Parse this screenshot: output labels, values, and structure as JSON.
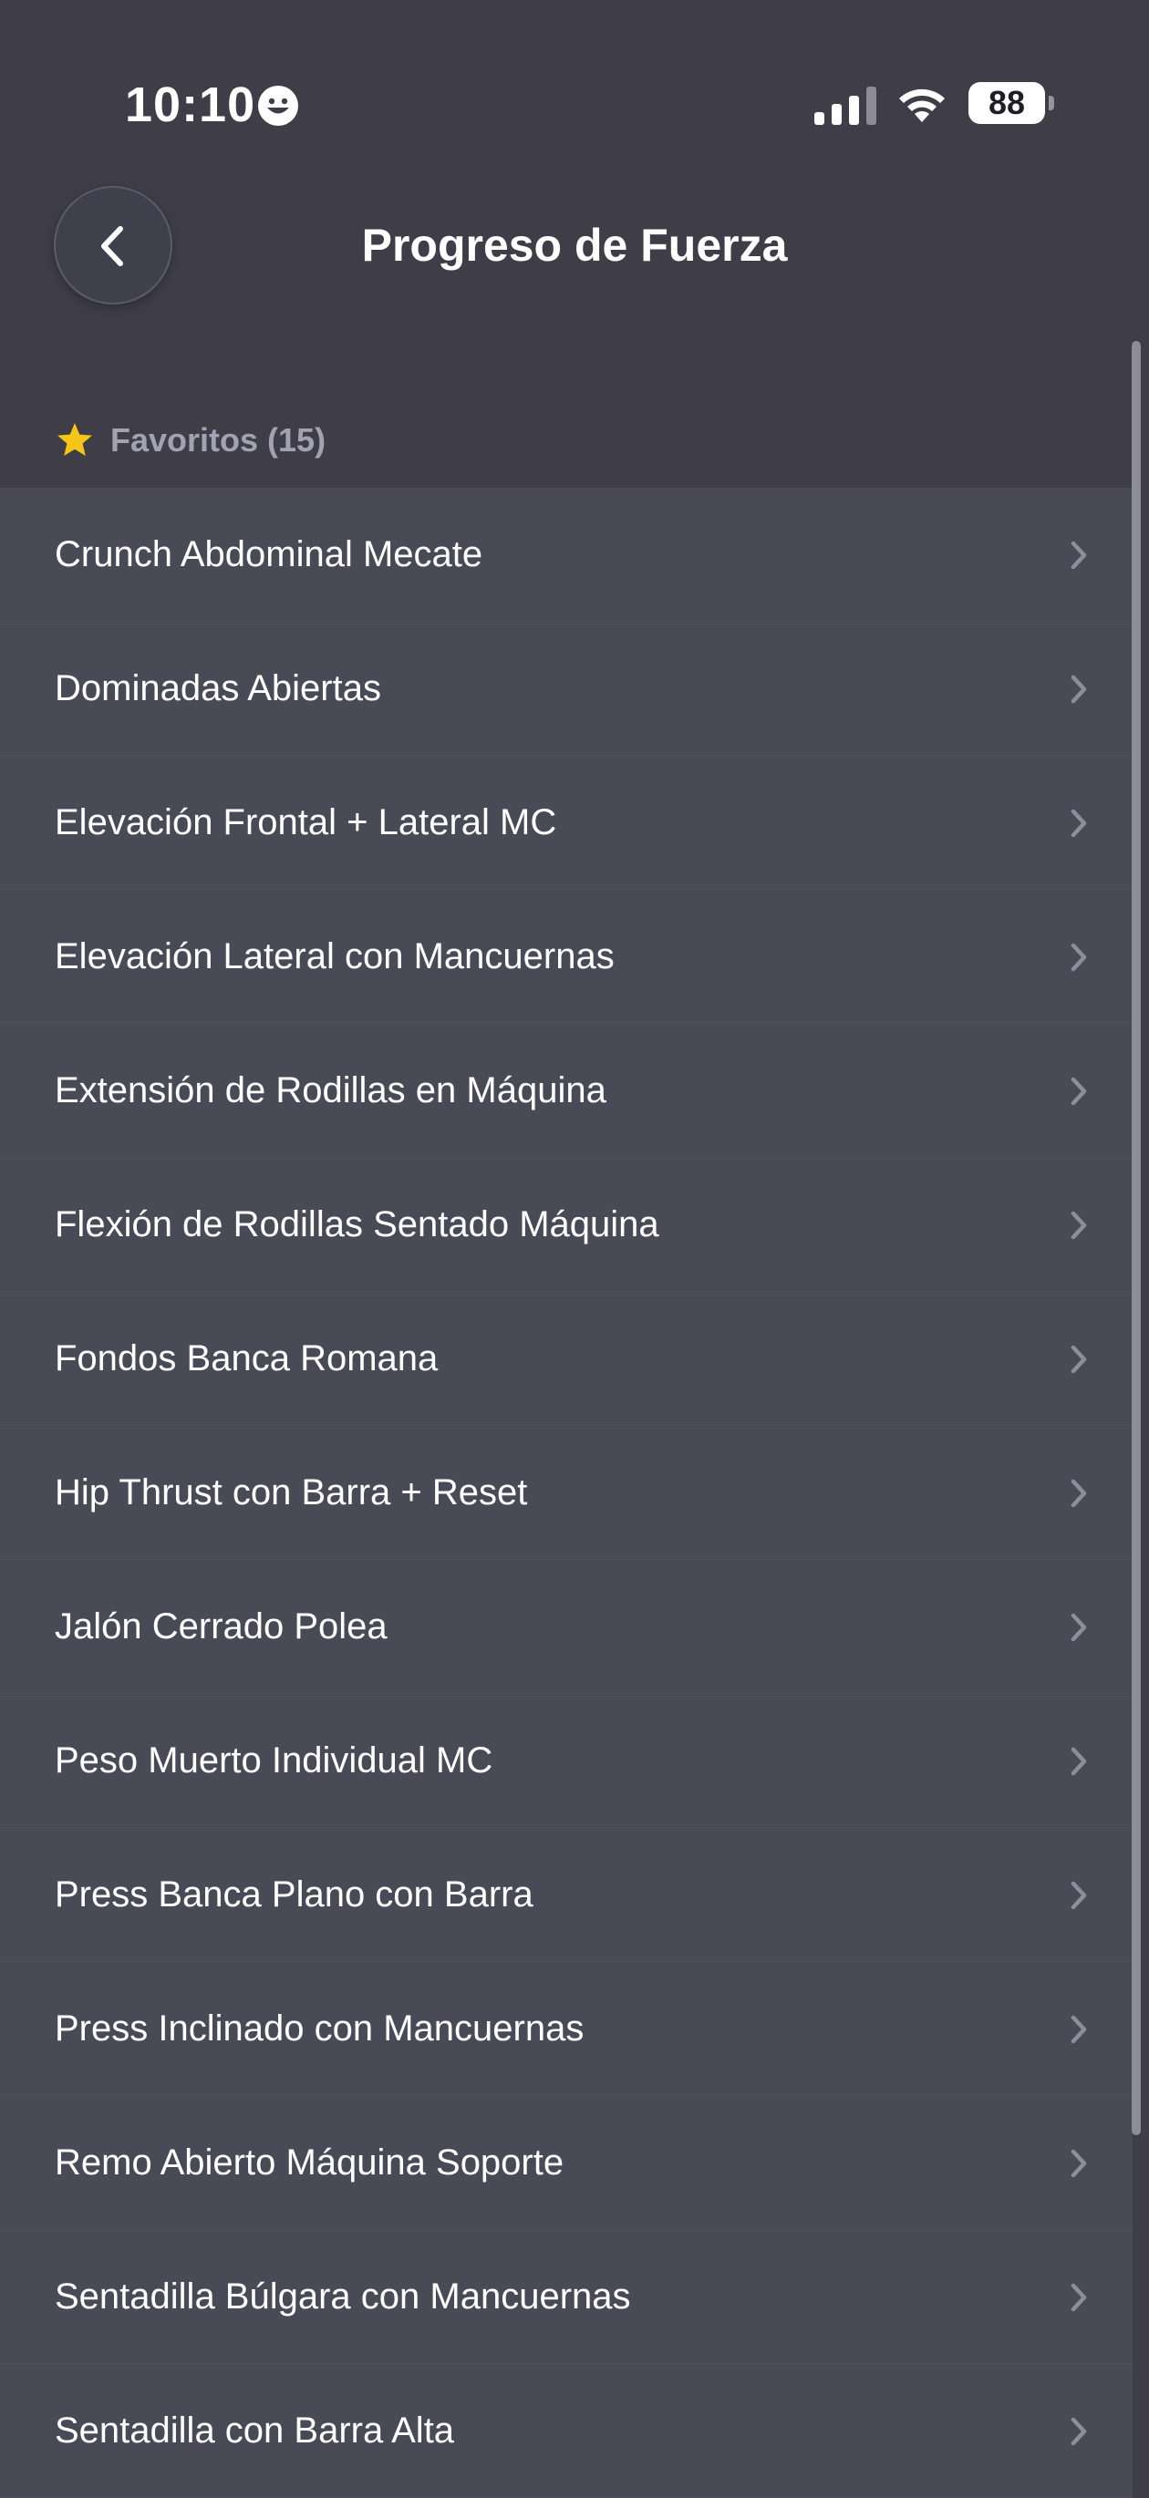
{
  "status_bar": {
    "time": "10:10",
    "battery": "88"
  },
  "header": {
    "title": "Progreso de Fuerza"
  },
  "section": {
    "title": "Favoritos (15)"
  },
  "exercises": [
    "Crunch Abdominal Mecate",
    "Dominadas Abiertas",
    "Elevación Frontal + Lateral MC",
    "Elevación Lateral con Mancuernas",
    "Extensión de Rodillas en Máquina",
    "Flexión de Rodillas Sentado Máquina",
    "Fondos Banca Romana",
    "Hip Thrust con Barra + Reset",
    "Jalón Cerrado Polea",
    "Peso Muerto Individual MC",
    "Press Banca Plano con Barra",
    "Press Inclinado con Mancuernas",
    "Remo Abierto Máquina Soporte",
    "Sentadilla Búlgara con Mancuernas",
    "Sentadilla con Barra Alta"
  ],
  "colors": {
    "background": "#3e3d48",
    "list_background": "#4a4956",
    "star": "#f5c518",
    "muted_text": "#a3a2b2"
  },
  "icons": {
    "back": "chevron-left-icon",
    "row_action": "chevron-right-icon",
    "section": "star-icon"
  }
}
